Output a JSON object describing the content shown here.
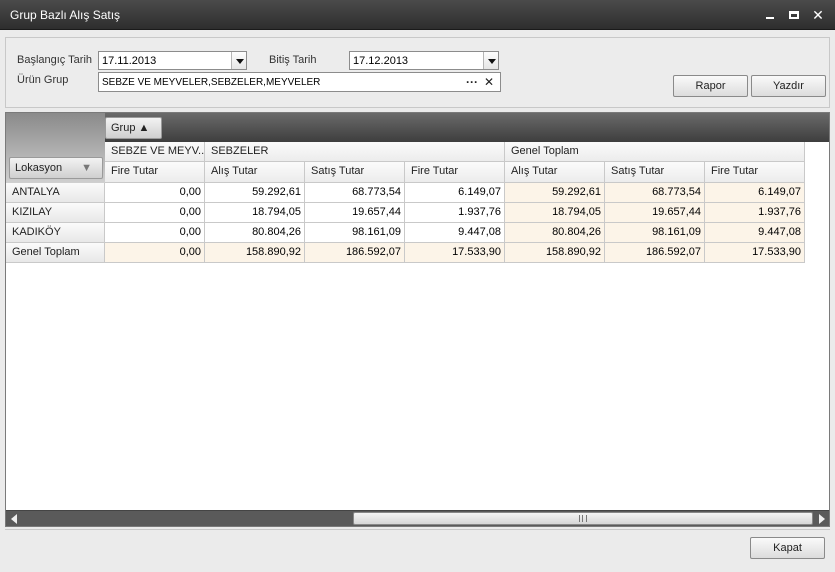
{
  "window": {
    "title": "Grup Bazlı Alış Satış"
  },
  "filters": {
    "start_label": "Başlangıç Tarih",
    "start_value": "17.11.2013",
    "end_label": "Bitiş Tarih",
    "end_value": "17.12.2013",
    "group_label": "Ürün Grup",
    "group_value": "SEBZE VE MEYVELER,SEBZELER,MEYVELER",
    "ellipsis": "···",
    "clear": "✕"
  },
  "buttons": {
    "report": "Rapor",
    "print": "Yazdır",
    "close": "Kapat"
  },
  "pivot": {
    "column_field": "Grup ▲",
    "row_field": "Lokasyon",
    "row_field_arrow": "▼",
    "groups": [
      "SEBZE VE MEYV...",
      "SEBZELER",
      "Genel Toplam"
    ],
    "columns": [
      "Fire Tutar",
      "Alış Tutar",
      "Satış Tutar",
      "Fire Tutar",
      "Alış Tutar",
      "Satış Tutar",
      "Fire Tutar"
    ],
    "rows": [
      {
        "label": "ANTALYA",
        "values": [
          "0,00",
          "59.292,61",
          "68.773,54",
          "6.149,07",
          "59.292,61",
          "68.773,54",
          "6.149,07"
        ]
      },
      {
        "label": "KIZILAY",
        "values": [
          "0,00",
          "18.794,05",
          "19.657,44",
          "1.937,76",
          "18.794,05",
          "19.657,44",
          "1.937,76"
        ]
      },
      {
        "label": "KADIKÖY",
        "values": [
          "0,00",
          "80.804,26",
          "98.161,09",
          "9.447,08",
          "80.804,26",
          "98.161,09",
          "9.447,08"
        ]
      },
      {
        "label": "Genel Toplam",
        "values": [
          "0,00",
          "158.890,92",
          "186.592,07",
          "17.533,90",
          "158.890,92",
          "186.592,07",
          "17.533,90"
        ]
      }
    ]
  }
}
